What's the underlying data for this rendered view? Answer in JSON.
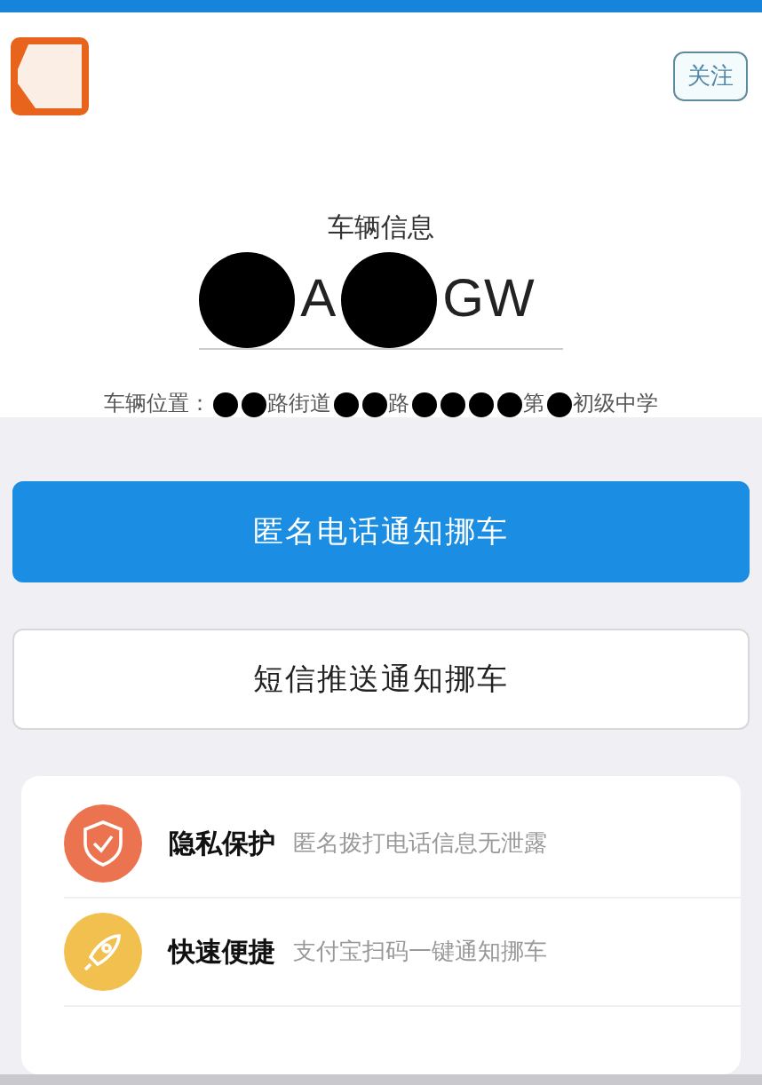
{
  "header": {
    "follow_button": "关注"
  },
  "vehicle": {
    "title": "车辆信息",
    "plate": [
      {
        "kind": "redaction"
      },
      {
        "kind": "text",
        "text": "A"
      },
      {
        "kind": "redaction"
      },
      {
        "kind": "text",
        "text": "GW"
      }
    ],
    "location": [
      {
        "kind": "text",
        "text": "车辆位置："
      },
      {
        "kind": "redaction"
      },
      {
        "kind": "redaction"
      },
      {
        "kind": "text",
        "text": "路街道"
      },
      {
        "kind": "redaction"
      },
      {
        "kind": "redaction"
      },
      {
        "kind": "text",
        "text": "路"
      },
      {
        "kind": "redaction"
      },
      {
        "kind": "redaction"
      },
      {
        "kind": "redaction"
      },
      {
        "kind": "redaction"
      },
      {
        "kind": "text",
        "text": "第"
      },
      {
        "kind": "redaction"
      },
      {
        "kind": "text",
        "text": "初级中学"
      }
    ]
  },
  "buttons": [
    {
      "label": "匿名电话通知挪车",
      "primary": true
    },
    {
      "label": "短信推送通知挪车",
      "primary": false
    }
  ],
  "features": [
    {
      "kind": "shield",
      "title": "隐私保护",
      "desc": "匿名拨打电话信息无泄露",
      "color": "#ec7350"
    },
    {
      "kind": "rocket",
      "title": "快速便捷",
      "desc": "支付宝扫码一键通知挪车",
      "color": "#f2c04e"
    }
  ]
}
